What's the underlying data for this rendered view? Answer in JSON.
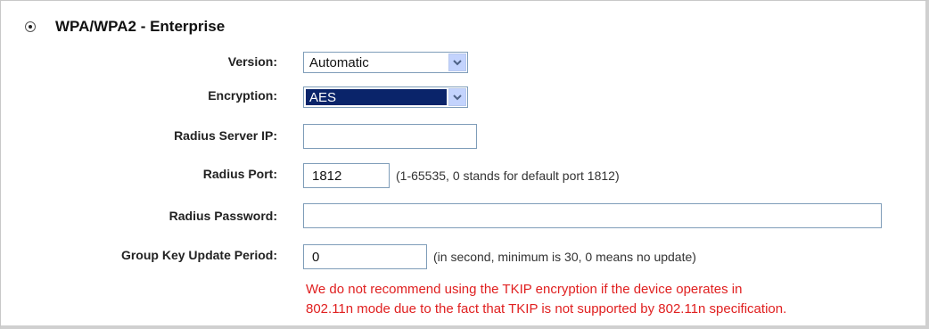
{
  "section": {
    "title": "WPA/WPA2 - Enterprise",
    "selected": true
  },
  "fields": {
    "version": {
      "label": "Version:",
      "value": "Automatic"
    },
    "encryption": {
      "label": "Encryption:",
      "value": "AES"
    },
    "radius_ip": {
      "label": "Radius Server IP:",
      "value": ""
    },
    "radius_port": {
      "label": "Radius Port:",
      "value": "1812",
      "hint": "(1-65535, 0 stands for default port 1812)"
    },
    "radius_password": {
      "label": "Radius Password:",
      "value": ""
    },
    "group_key": {
      "label": "Group Key Update Period:",
      "value": "0",
      "hint": "(in second, minimum is 30, 0 means no update)"
    }
  },
  "warning": {
    "line1": "We do not recommend using the TKIP encryption if the device operates in",
    "line2": "802.11n mode due to the fact that TKIP is not supported by 802.11n specification."
  },
  "colors": {
    "warning": "#e02020",
    "selection": "#0a246a",
    "dropdown_button": "#c3d3fd"
  }
}
